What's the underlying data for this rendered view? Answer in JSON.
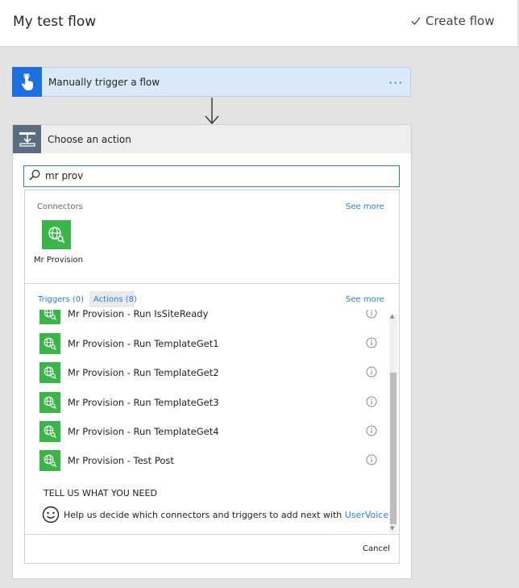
{
  "header": {
    "title": "My test flow",
    "create_flow_label": "Create flow"
  },
  "trigger": {
    "label": "Manually trigger a flow",
    "more": "···"
  },
  "action": {
    "label": "Choose an action"
  },
  "search": {
    "value": "mr prov",
    "placeholder": ""
  },
  "connectors": {
    "section_label": "Connectors",
    "see_more": "See more",
    "items": [
      {
        "name": "Mr Provision"
      }
    ]
  },
  "tabs": {
    "triggers": "Triggers (0)",
    "actions": "Actions (8)",
    "see_more": "See more"
  },
  "actions_list": [
    {
      "label": "Mr Provision - Run IsSiteReady"
    },
    {
      "label": "Mr Provision - Run TemplateGet1"
    },
    {
      "label": "Mr Provision - Run TemplateGet2"
    },
    {
      "label": "Mr Provision - Run TemplateGet3"
    },
    {
      "label": "Mr Provision - Run TemplateGet4"
    },
    {
      "label": "Mr Provision - Test Post"
    }
  ],
  "feedback": {
    "heading": "TELL US WHAT YOU NEED",
    "text": "Help us decide which connectors and triggers to add next with ",
    "link": "UserVoice"
  },
  "cancel_label": "Cancel",
  "colors": {
    "accent": "#2b7cd3",
    "trigger_bg": "#dbeafb",
    "trigger_icon": "#1f6fe0",
    "connector_green": "#3bb44a",
    "action_icon_bg": "#5a6d81"
  },
  "icons": {
    "trigger": "hand-touch-icon",
    "action": "action-step-icon",
    "connector": "globe-search-icon",
    "info": "info-icon"
  }
}
